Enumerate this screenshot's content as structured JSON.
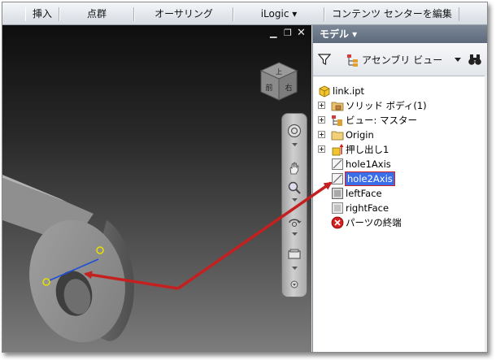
{
  "ribbon": {
    "tabs": [
      "挿入",
      "点群",
      "オーサリング",
      "iLogic ▾",
      "コンテンツ センターを編集"
    ]
  },
  "viewport": {
    "viewcube": {
      "top_face": "上",
      "front_face": "前",
      "right_face": "右"
    }
  },
  "browser": {
    "title": "モデル ▾",
    "view_selector": "アセンブリ ビュー",
    "tree": [
      {
        "label": "link.ipt",
        "icon": "part-icon"
      },
      {
        "label": "ソリッド ボディ(1)",
        "icon": "solid-bodies-folder-icon"
      },
      {
        "label": "ビュー: マスター",
        "icon": "view-rep-icon"
      },
      {
        "label": "Origin",
        "icon": "origin-folder-icon"
      },
      {
        "label": "押し出し1",
        "icon": "extrusion-icon"
      },
      {
        "label": "hole1Axis",
        "icon": "work-axis-icon"
      },
      {
        "label": "hole2Axis",
        "icon": "work-axis-icon",
        "selected": true
      },
      {
        "label": "leftFace",
        "icon": "work-plane-icon"
      },
      {
        "label": "rightFace",
        "icon": "work-plane-icon"
      },
      {
        "label": "パーツの終端",
        "icon": "end-of-part-icon"
      }
    ]
  },
  "colors": {
    "annotation_arrow": "#c42020",
    "selection": "#3a6ee8",
    "axis_line": "#1d4fd6",
    "point_marker": "#e8e000"
  }
}
